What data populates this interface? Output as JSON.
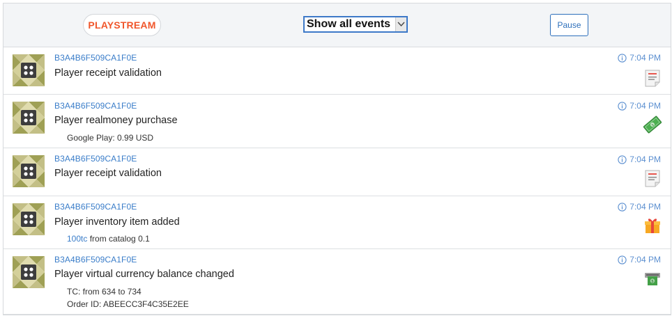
{
  "header": {
    "playstream_label": "PLAYSTREAM",
    "filter_value": "Show all events",
    "pause_label": "Pause"
  },
  "events": [
    {
      "player_id": "B3A4B6F509CA1F0E",
      "title": "Player receipt validation",
      "time": "7:04 PM",
      "icon": "receipt-icon"
    },
    {
      "player_id": "B3A4B6F509CA1F0E",
      "title": "Player realmoney purchase",
      "details": [
        "Google Play: 0.99 USD"
      ],
      "time": "7:04 PM",
      "icon": "money-icon"
    },
    {
      "player_id": "B3A4B6F509CA1F0E",
      "title": "Player receipt validation",
      "time": "7:04 PM",
      "icon": "receipt-icon"
    },
    {
      "player_id": "B3A4B6F509CA1F0E",
      "title": "Player inventory item added",
      "detail_link": "100tc",
      "detail_rest": "from catalog 0.1",
      "time": "7:04 PM",
      "icon": "gift-icon"
    },
    {
      "player_id": "B3A4B6F509CA1F0E",
      "title": "Player virtual currency balance changed",
      "details": [
        "TC: from 634 to 734",
        "Order ID: ABEECC3F4C35E2EE"
      ],
      "time": "7:04 PM",
      "icon": "currency-icon"
    }
  ],
  "colors": {
    "accent_orange": "#f0562b",
    "link_blue": "#3a7dc9",
    "pause_blue": "#2d6fbb",
    "header_bg": "#f3f5f7"
  }
}
